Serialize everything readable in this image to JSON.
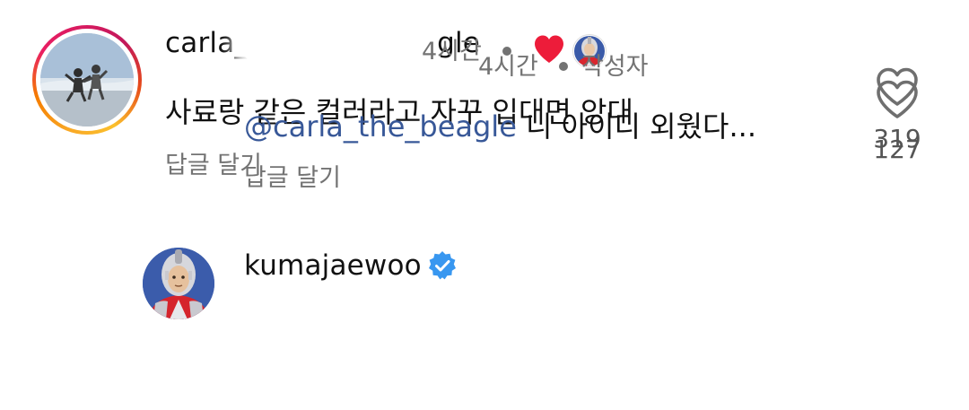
{
  "comments": [
    {
      "username": "carla_the_beagle",
      "username_visible_left": "carla_",
      "username_visible_right": "gle",
      "time": "4시간",
      "text": "사료랑 같은 컬러라고 자꾸 입대면 앙대",
      "reply_label": "답글 달기",
      "likes": "319",
      "liked_by_author": true,
      "colors": {
        "heart": "#ed1c3a",
        "ring_start": "#f9a825",
        "ring_end": "#d81b60"
      }
    },
    {
      "username": "kumajaewoo",
      "verified": true,
      "time": "4시간",
      "author_label": "작성자",
      "mention": "@carla_the_beagle",
      "text": "니 아이디 외웠다...",
      "reply_label": "답글 달기",
      "likes": "127",
      "colors": {
        "verified": "#3897f0",
        "mention": "#385898"
      }
    }
  ]
}
